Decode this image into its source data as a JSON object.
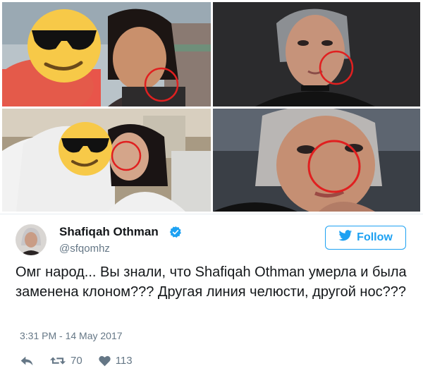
{
  "tweet": {
    "display_name": "Shafiqah Othman",
    "handle": "@sfqomhz",
    "follow_label": "Follow",
    "text": "Омг народ... Вы знали, что Shafiqah Othman умерла и была заменена клоном??? Другая линия челюсти, другой нос???",
    "timestamp": "3:31 PM - 14 May 2017",
    "retweet_count": "70",
    "like_count": "113"
  },
  "icons": {
    "verified": "verified-badge-icon",
    "follow": "twitter-bird-icon",
    "reply": "reply-icon",
    "retweet": "retweet-icon",
    "like": "heart-icon",
    "censor": "sunglasses-emoji"
  },
  "colors": {
    "twitter_blue": "#1da1f2",
    "text": "#14171a",
    "muted": "#657786",
    "circle": "#e02020"
  }
}
